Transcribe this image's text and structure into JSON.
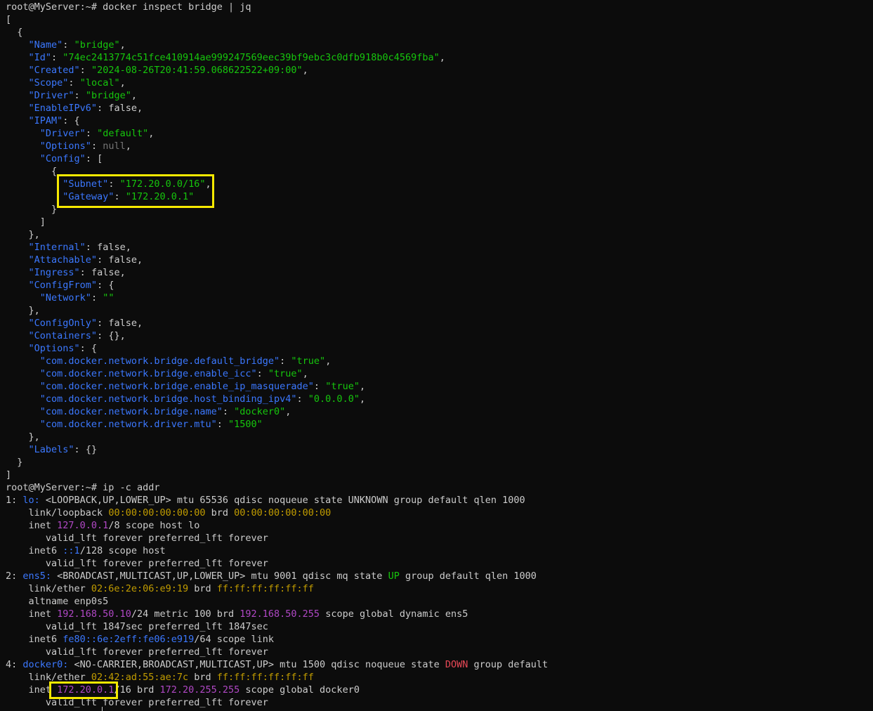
{
  "prompt1": "root@MyServer:~# ",
  "cmd1": "docker inspect bridge | jq",
  "json": {
    "open_bracket": "[",
    "open_brace": "{",
    "Name": "\"bridge\"",
    "Id": "\"74ec2413774c51fce410914ae999247569eec39bf9ebc3c0dfb918b0c4569fba\"",
    "Created": "\"2024-08-26T20:41:59.068622522+09:00\"",
    "Scope": "\"local\"",
    "Driver": "\"bridge\"",
    "EnableIPv6": "false",
    "IPAM_Driver": "\"default\"",
    "IPAM_Options": "null",
    "Subnet": "\"172.20.0.0/16\"",
    "Gateway": "\"172.20.0.1\"",
    "Internal": "false",
    "Attachable": "false",
    "Ingress": "false",
    "ConfigFrom_Network": "\"\"",
    "ConfigOnly": "false",
    "Containers": "{}",
    "opt_default_bridge_v": "\"true\"",
    "opt_enable_icc_v": "\"true\"",
    "opt_enable_ip_masquerade_v": "\"true\"",
    "opt_host_binding_ipv4_v": "\"0.0.0.0\"",
    "opt_name_v": "\"docker0\"",
    "opt_mtu_v": "\"1500\"",
    "Labels": "{}"
  },
  "keys": {
    "Name": "\"Name\"",
    "Id": "\"Id\"",
    "Created": "\"Created\"",
    "Scope": "\"Scope\"",
    "Driver": "\"Driver\"",
    "EnableIPv6": "\"EnableIPv6\"",
    "IPAM": "\"IPAM\"",
    "Options": "\"Options\"",
    "Config": "\"Config\"",
    "Subnet": "\"Subnet\"",
    "Gateway": "\"Gateway\"",
    "Internal": "\"Internal\"",
    "Attachable": "\"Attachable\"",
    "Ingress": "\"Ingress\"",
    "ConfigFrom": "\"ConfigFrom\"",
    "Network": "\"Network\"",
    "ConfigOnly": "\"ConfigOnly\"",
    "Containers": "\"Containers\"",
    "opt_default_bridge": "\"com.docker.network.bridge.default_bridge\"",
    "opt_enable_icc": "\"com.docker.network.bridge.enable_icc\"",
    "opt_enable_ip_masquerade": "\"com.docker.network.bridge.enable_ip_masquerade\"",
    "opt_host_binding_ipv4": "\"com.docker.network.bridge.host_binding_ipv4\"",
    "opt_name": "\"com.docker.network.bridge.name\"",
    "opt_mtu": "\"com.docker.network.driver.mtu\"",
    "Labels": "\"Labels\""
  },
  "prompt2": "root@MyServer:~# ",
  "cmd2": "ip -c addr",
  "ip": {
    "lo_idx": "1: ",
    "lo_name": "lo:",
    "lo_flags": " <LOOPBACK,UP,LOWER_UP> mtu 65536 qdisc noqueue state UNKNOWN group default qlen 1000",
    "lo_link": "link/loopback ",
    "lo_mac": "00:00:00:00:00:00",
    "lo_brd": " brd ",
    "lo_brdmac": "00:00:00:00:00:00",
    "lo_inet": "inet ",
    "lo_ip": "127.0.0.1",
    "lo_inet_rest": "/8 scope host lo",
    "lft_forever": "valid_lft forever preferred_lft forever",
    "lo_inet6": "inet6 ",
    "lo_ip6": "::1",
    "lo_inet6_rest": "/128 scope host",
    "ens5_idx": "2: ",
    "ens5_name": "ens5:",
    "ens5_flags_a": " <BROADCAST,MULTICAST,UP,LOWER_UP> mtu 9001 qdisc mq state ",
    "ens5_state": "UP",
    "ens5_flags_b": " group default qlen 1000",
    "ens5_link": "link/ether ",
    "ens5_mac": "02:6e:2e:06:e9:19",
    "ens5_brd": " brd ",
    "ens5_brdmac": "ff:ff:ff:ff:ff:ff",
    "ens5_altname": "altname enp0s5",
    "ens5_inet": "inet ",
    "ens5_ip": "192.168.50.10",
    "ens5_inet_mid": "/24 metric 100 brd ",
    "ens5_bcast": "192.168.50.255",
    "ens5_inet_rest": " scope global dynamic ens5",
    "ens5_lft": "valid_lft 1847sec preferred_lft 1847sec",
    "ens5_inet6": "inet6 ",
    "ens5_ip6": "fe80::6e:2eff:fe06:e919",
    "ens5_inet6_rest": "/64 scope link",
    "d0_idx": "4: ",
    "d0_name": "docker0:",
    "d0_flags_a": " <NO-CARRIER,BROADCAST,MULTICAST,UP> mtu 1500 qdisc noqueue state ",
    "d0_state": "DOWN",
    "d0_flags_b": " group default",
    "d0_link": "link/ether ",
    "d0_mac": "02:42:ad:55:ae:7c",
    "d0_brd": " brd ",
    "d0_brdmac": "ff:ff:ff:ff:ff:ff",
    "d0_inet": "inet ",
    "d0_ip": "172.20.0.1",
    "d0_inet_mid": "/16 brd ",
    "d0_bcast": "172.20.255.255",
    "d0_inet_rest": " scope global docker0"
  },
  "colors": {
    "background": "#0c0c0c",
    "text": "#cccccc",
    "key": "#3b78ff",
    "string": "#16c60c",
    "mac": "#c19c00",
    "ip": "#b148c6",
    "down": "#e74856",
    "highlight": "#f6e900"
  }
}
